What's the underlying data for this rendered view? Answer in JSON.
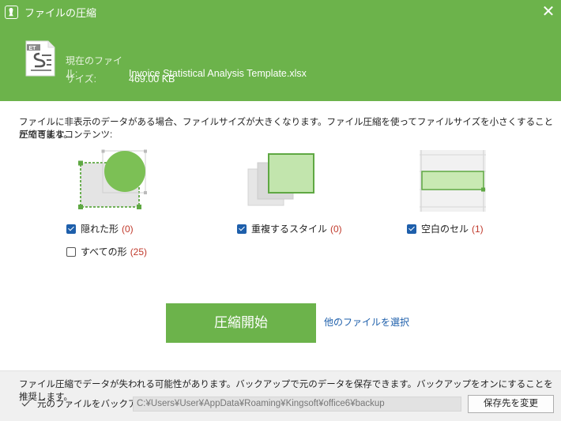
{
  "window": {
    "title": "ファイルの圧縮",
    "close_glyph": "✕"
  },
  "file_info": {
    "icon_text": "ET",
    "current_file_label": "現在のファイル:",
    "current_file_name": "Invoice Statistical Analysis Template.xlsx",
    "size_label": "サイズ:",
    "size_value": "469.00 KB"
  },
  "description": {
    "line1": "ファイルに非表示のデータがある場合、ファイルサイズが大きくなります。ファイル圧縮を使ってファイルサイズを小さくすることができます。",
    "line2": "圧縮可能なコンテンツ:"
  },
  "options": {
    "hidden_shapes": {
      "label": "隠れた形",
      "count": "(0)",
      "checked": true
    },
    "all_shapes": {
      "label": "すべての形",
      "count": "(25)",
      "checked": false
    },
    "duplicate_styles": {
      "label": "重複するスタイル",
      "count": "(0)",
      "checked": true
    },
    "blank_cells": {
      "label": "空白のセル",
      "count": "(1)",
      "checked": true
    }
  },
  "actions": {
    "start_label": "圧縮開始",
    "other_file_label": "他のファイルを選択"
  },
  "footer": {
    "warning": "ファイル圧縮でデータが失われる可能性があります。バックアップで元のデータを保存できます。バックアップをオンにすることを推奨します。",
    "backup_label": "元のファイルをバックアップ",
    "backup_checked": true,
    "backup_path": "C:¥Users¥User¥AppData¥Roaming¥Kingsoft¥office6¥backup",
    "change_dest_label": "保存先を変更"
  },
  "colors": {
    "accent_green": "#6cb34b",
    "checkbox_blue": "#1e5fab",
    "count_red": "#c0392b",
    "link_blue": "#1e5fab"
  }
}
